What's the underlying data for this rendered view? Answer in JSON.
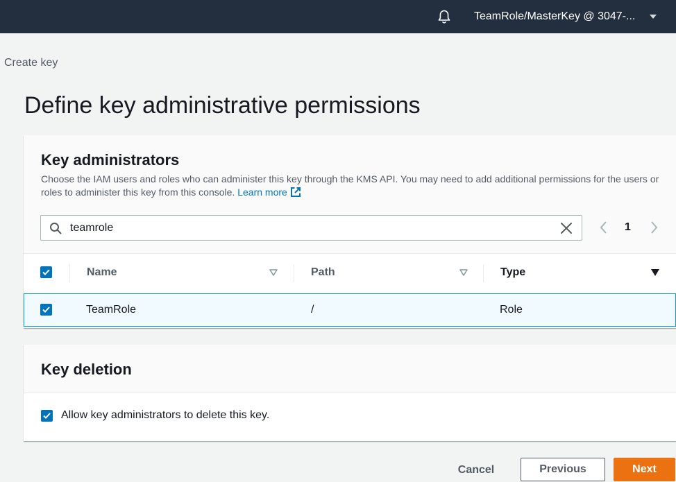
{
  "topbar": {
    "account_label": "TeamRole/MasterKey @ 3047-...",
    "bell_icon": "bell-icon",
    "caret_icon": "caret-down-icon"
  },
  "breadcrumb": "Create key",
  "page_title": "Define key administrative permissions",
  "admins": {
    "title": "Key administrators",
    "description": "Choose the IAM users and roles who can administer this key through the KMS API. You may need to add additional permissions for the users or roles to administer this key from this console.",
    "learn_more": "Learn more",
    "search": {
      "value": "teamrole",
      "icon": "search-icon",
      "clear_icon": "close-icon"
    },
    "pager": {
      "page": "1"
    },
    "columns": [
      "Name",
      "Path",
      "Type"
    ],
    "rows": [
      {
        "name": "TeamRole",
        "path": "/",
        "type": "Role",
        "checked": true
      }
    ]
  },
  "deletion": {
    "title": "Key deletion",
    "allow_label": "Allow key administrators to delete this key.",
    "checked": true
  },
  "footer": {
    "cancel": "Cancel",
    "previous": "Previous",
    "next": "Next"
  },
  "colors": {
    "topbar": "#232f3e",
    "primary": "#ec7211",
    "link": "#0073bb",
    "selected_row_bg": "#f1faff",
    "selected_row_border": "#00a1c9"
  }
}
